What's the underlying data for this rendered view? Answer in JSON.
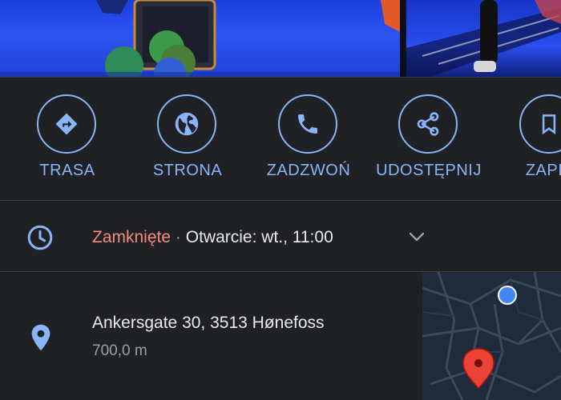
{
  "actions": [
    {
      "label": "TRASA",
      "icon": "directions-icon"
    },
    {
      "label": "STRONA",
      "icon": "globe-icon"
    },
    {
      "label": "ZADZWOŃ",
      "icon": "phone-icon"
    },
    {
      "label": "UDOSTĘPNIJ",
      "icon": "share-icon"
    },
    {
      "label": "ZAPIS",
      "icon": "bookmark-icon"
    }
  ],
  "hours": {
    "status": "Zamknięte",
    "separator": "·",
    "next_open": "Otwarcie: wt., 11:00"
  },
  "address": {
    "line": "Ankersgate 30, 3513 Hønefoss",
    "distance": "700,0 m"
  },
  "colors": {
    "accent": "#8ab4f8",
    "closed": "#f28b82",
    "background": "#202124",
    "text": "#e8eaed",
    "secondary_text": "#9aa0a6",
    "map_pin": "#ea4335",
    "location_dot": "#4285f4"
  }
}
